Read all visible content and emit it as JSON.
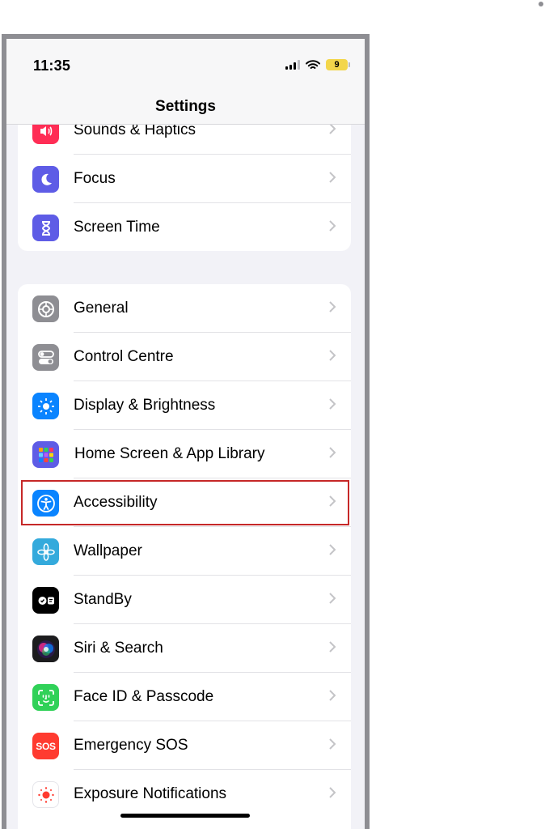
{
  "status_bar": {
    "time": "11:35",
    "battery": "9"
  },
  "nav": {
    "title": "Settings"
  },
  "group1": [
    {
      "label": "Sounds & Haptics",
      "icon": "speaker-icon",
      "color": "#ff2d55"
    },
    {
      "label": "Focus",
      "icon": "moon-icon",
      "color": "#5e5ce6"
    },
    {
      "label": "Screen Time",
      "icon": "hourglass-icon",
      "color": "#5e5ce6"
    }
  ],
  "group2": [
    {
      "label": "General",
      "icon": "gear-icon",
      "color": "#8e8e93"
    },
    {
      "label": "Control Centre",
      "icon": "toggles-icon",
      "color": "#8e8e93"
    },
    {
      "label": "Display & Brightness",
      "icon": "sun-icon",
      "color": "#0a84ff"
    },
    {
      "label": "Home Screen & App Library",
      "icon": "app-grid-icon",
      "color": "#5e5ce6"
    },
    {
      "label": "Accessibility",
      "icon": "accessibility-icon",
      "color": "#0a84ff"
    },
    {
      "label": "Wallpaper",
      "icon": "flower-icon",
      "color": "#34aadc"
    },
    {
      "label": "StandBy",
      "icon": "standby-icon",
      "color": "#000000"
    },
    {
      "label": "Siri & Search",
      "icon": "siri-icon",
      "color": "#1c1c1e"
    },
    {
      "label": "Face ID & Passcode",
      "icon": "face-id-icon",
      "color": "#30d158"
    },
    {
      "label": "Emergency SOS",
      "icon": "sos-icon",
      "color": "#ff3b30"
    },
    {
      "label": "Exposure Notifications",
      "icon": "exposure-icon",
      "color": "#ffffff"
    }
  ],
  "sos_text": "SOS",
  "highlighted_item": "Accessibility",
  "colors": {
    "highlight": "#c62828",
    "background": "#f2f2f7"
  }
}
